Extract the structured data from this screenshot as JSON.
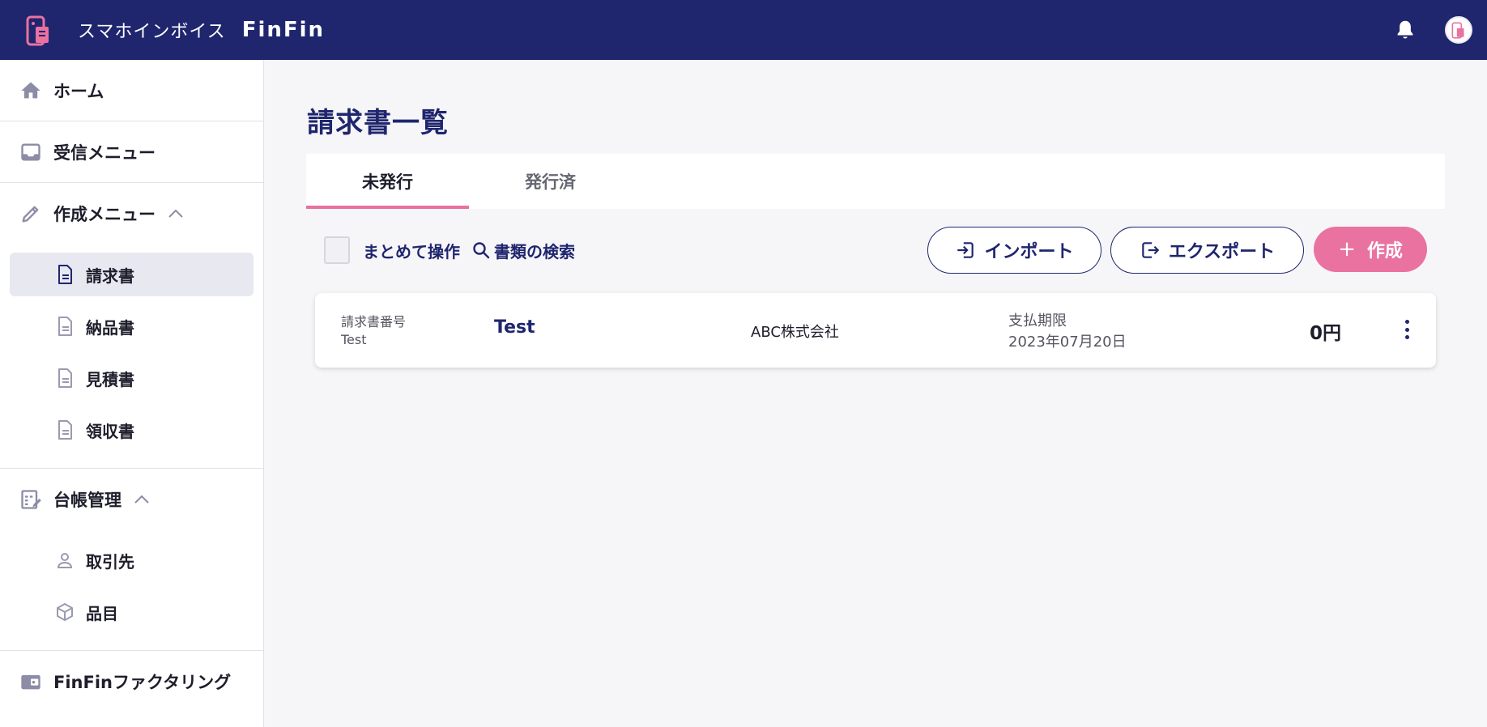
{
  "header": {
    "brand_name": "スマホインボイス",
    "brand_name_en": "FinFin"
  },
  "sidebar": {
    "home": "ホーム",
    "inbox": "受信メニュー",
    "create_menu": "作成メニュー",
    "create_items": [
      {
        "label": "請求書",
        "active": true
      },
      {
        "label": "納品書"
      },
      {
        "label": "見積書"
      },
      {
        "label": "領収書"
      }
    ],
    "ledger": "台帳管理",
    "ledger_items": [
      {
        "label": "取引先"
      },
      {
        "label": "品目"
      }
    ],
    "factoring": "FinFinファクタリング"
  },
  "main": {
    "title": "請求書一覧",
    "tabs": [
      {
        "label": "未発行",
        "active": true
      },
      {
        "label": "発行済"
      }
    ],
    "toolbar": {
      "bulk_label": "まとめて操作",
      "search_label": "書類の検索",
      "import_label": "インポート",
      "export_label": "エクスポート",
      "create_label": "作成"
    },
    "invoices": [
      {
        "number_label": "請求書番号",
        "number": "Test",
        "title": "Test",
        "client": "ABC株式会社",
        "due_label": "支払期限",
        "due_date": "2023年07月20日",
        "amount": "0円"
      }
    ]
  },
  "colors": {
    "header_bg": "#1f266e",
    "accent_pink": "#ea72a0",
    "navy_text": "#1f266e"
  }
}
